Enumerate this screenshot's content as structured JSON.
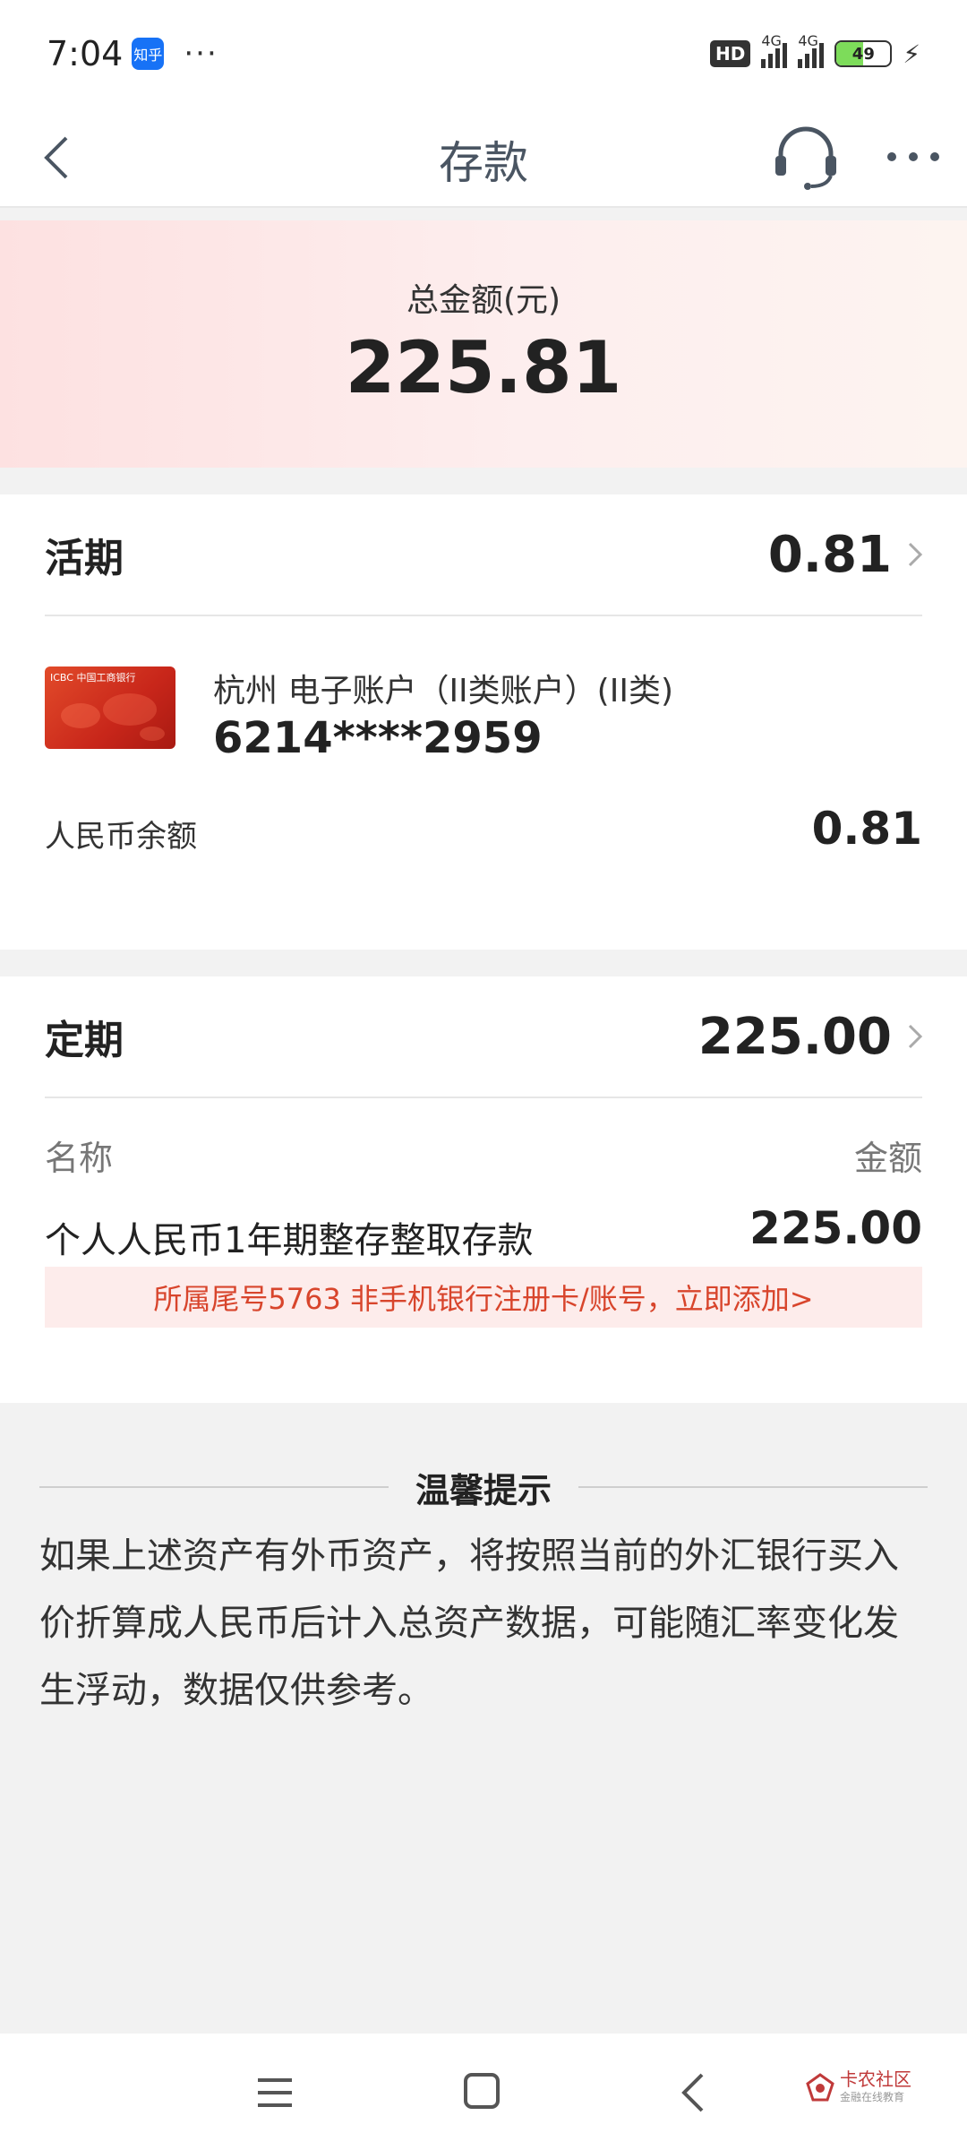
{
  "status_bar": {
    "time": "7:04",
    "app_badge": "知乎",
    "dots": "···",
    "hd_label": "HD",
    "network_1": "4G",
    "network_2": "4G",
    "battery": "49",
    "battery_level": 0.49
  },
  "nav": {
    "title": "存款",
    "back_icon": "back-arrow-icon",
    "service_icon": "headset-icon",
    "more_icon": "more-dots-icon"
  },
  "total": {
    "label": "总金额(元)",
    "value": "225.81"
  },
  "demand": {
    "title": "活期",
    "amount": "0.81",
    "bank_card_logo": "ICBC 中国工商银行",
    "account_name": "杭州 电子账户（II类账户）(II类)",
    "account_number": "6214****2959",
    "rmb_label": "人民币余额",
    "rmb_value": "0.81"
  },
  "fixed": {
    "title": "定期",
    "amount": "225.00",
    "col_name": "名称",
    "col_amount": "金额",
    "rows": [
      {
        "name": "个人人民币1年期整存整取存款",
        "amount": "225.00"
      }
    ],
    "notice": "所属尾号5763 非手机银行注册卡/账号，立即添加>"
  },
  "tips": {
    "title": "温馨提示",
    "body": "如果上述资产有外币资产，将按照当前的外汇银行买入价折算成人民币后计入总资产数据，可能随汇率变化发生浮动，数据仅供参考。"
  },
  "watermark": {
    "title": "卡农社区",
    "subtitle": "金融在线教育"
  },
  "colors": {
    "accent_red": "#d8452c",
    "notice_bg": "#fdeceb",
    "banner_pink": "#fde1e1"
  }
}
